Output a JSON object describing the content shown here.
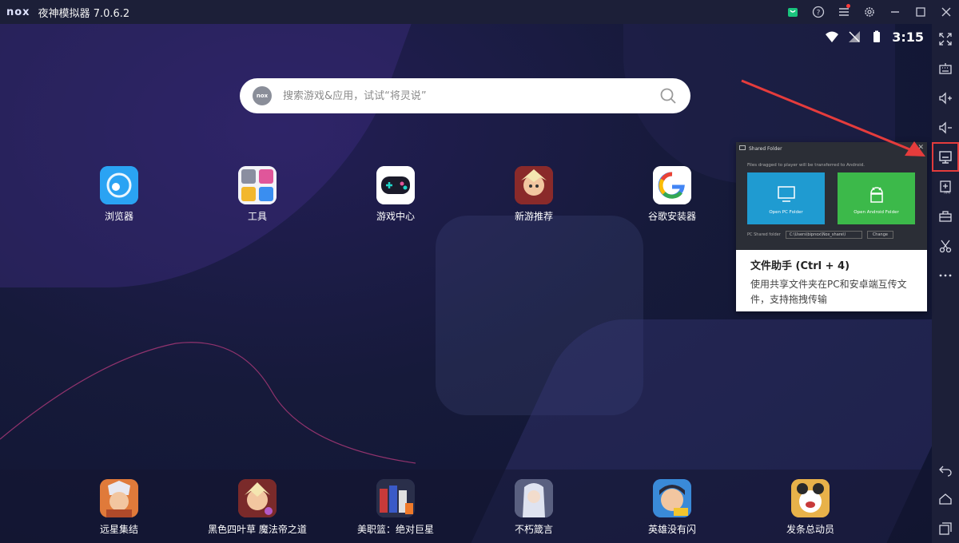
{
  "window": {
    "logo": "nox",
    "title": "夜神模拟器 7.0.6.2"
  },
  "titlebar_icons": [
    "shopping-bag-icon",
    "help-icon",
    "menu-icon",
    "settings-icon",
    "minimize-icon",
    "maximize-icon",
    "close-icon"
  ],
  "status": {
    "time": "3:15"
  },
  "search": {
    "logo": "nox",
    "placeholder": "搜索游戏&应用，试试“将灵说”"
  },
  "apps": [
    {
      "label": "浏览器",
      "icon": "browser-icon",
      "color": "#2a9ff0"
    },
    {
      "label": "工具",
      "icon": "tools-icon",
      "color": "#e8e8f0"
    },
    {
      "label": "游戏中心",
      "icon": "game-center-icon",
      "color": "#ffffff"
    },
    {
      "label": "新游推荐",
      "icon": "new-games-icon",
      "color": "#c23a2a"
    },
    {
      "label": "谷歌安装器",
      "icon": "google-installer-icon",
      "color": "#ffffff"
    }
  ],
  "dock_apps": [
    {
      "label": "远星集结",
      "icon": "game-icon-1",
      "color": "#b9563a"
    },
    {
      "label": "黑色四叶草 魔法帝之道",
      "icon": "game-icon-2",
      "color": "#c23a2a"
    },
    {
      "label": "美职篮：绝对巨星",
      "icon": "game-icon-3",
      "color": "#3a3a7a"
    },
    {
      "label": "不朽箴言",
      "icon": "game-icon-4",
      "color": "#8a90b0"
    },
    {
      "label": "英雄没有闪",
      "icon": "game-icon-5",
      "color": "#4a6ec8"
    },
    {
      "label": "发条总动员",
      "icon": "game-icon-6",
      "color": "#d99a2a"
    }
  ],
  "sidebar": [
    "fullscreen-icon",
    "keyboard-icon",
    "volume-up-icon",
    "volume-down-icon",
    "shared-folder-icon",
    "apk-install-icon",
    "toolbox-icon",
    "screenshot-cut-icon",
    "more-icon"
  ],
  "sidebar_bottom": [
    "back-icon",
    "home-icon",
    "recent-apps-icon"
  ],
  "tooltip": {
    "preview_header": "Shared Folder",
    "preview_desc": "Files dragged to player will be transferred to Android.",
    "pc_folder": "Open PC Folder",
    "android_folder": "Open Android Folder",
    "pc_shared_label": "PC Shared folder",
    "pc_shared_path": "C:\\Users\\bipnox\\Nox_share\\I",
    "change_button": "Change",
    "title": "文件助手 (Ctrl + 4)",
    "body": "使用共享文件夹在PC和安卓端互传文件，支持拖拽传输"
  },
  "colors": {
    "accent_red": "#e53c3c",
    "pc_card": "#1f9bd1",
    "android_card": "#3cb94a"
  }
}
